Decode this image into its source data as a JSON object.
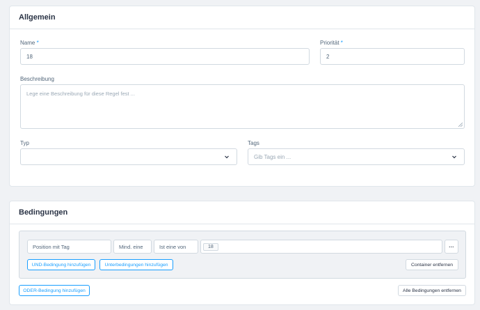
{
  "general": {
    "title": "Allgemein",
    "name_label": "Name",
    "required_mark": "*",
    "name_value": "18",
    "priority_label": "Priorität",
    "priority_value": "2",
    "description_label": "Beschreibung",
    "description_placeholder": "Lege eine Beschreibung für diese Regel fest ...",
    "type_label": "Typ",
    "type_value": "",
    "tags_label": "Tags",
    "tags_placeholder": "Gib Tags ein ..."
  },
  "conditions": {
    "title": "Bedingungen",
    "condition_type": "Position mit Tag",
    "quantifier": "Mind. eine",
    "operator": "Ist eine von",
    "value_tags": [
      "18"
    ],
    "more_label": "···",
    "add_and_label": "UND-Bedingung hinzufügen",
    "add_sub_label": "Unterbedingungen hinzufügen",
    "remove_container_label": "Container entfernen",
    "add_or_label": "ODER-Bedingung hinzufügen",
    "remove_all_label": "Alle Bedingungen entfernen"
  }
}
